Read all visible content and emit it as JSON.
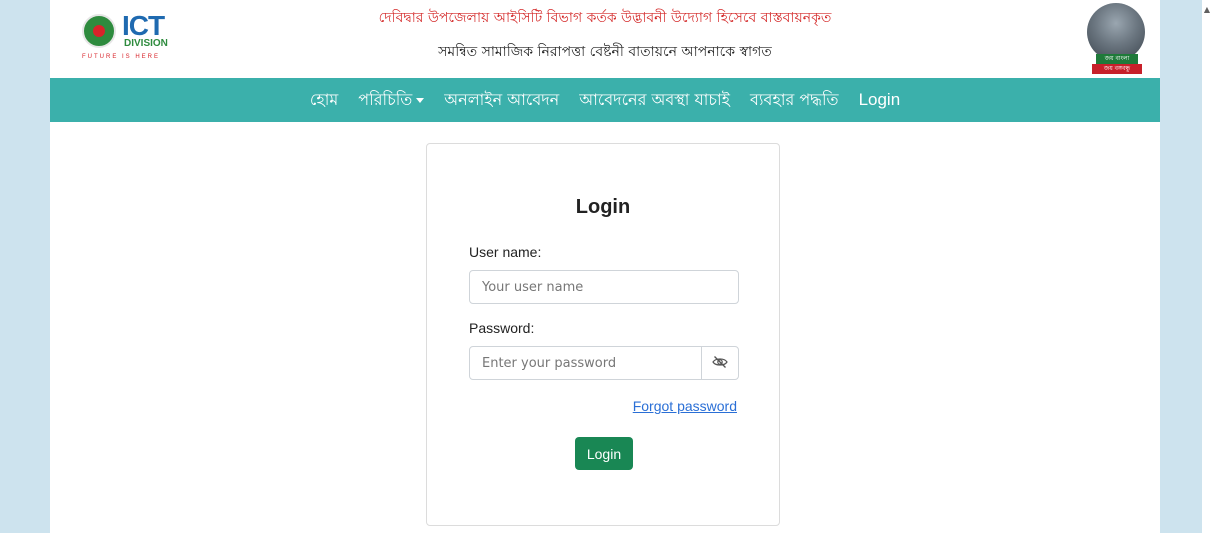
{
  "header": {
    "logo": {
      "name": "ICT",
      "division": "DIVISION",
      "tagline": "FUTURE IS HERE"
    },
    "line1": "দেবিদ্বার উপজেলায় আইসিটি বিভাগ কর্তক উদ্ভাবনী উদ্যোগ হিসেবে বাস্তবায়নকৃত",
    "line2": "সমন্বিত সামাজিক নিরাপত্তা বেষ্টনী বাতায়নে আপনাকে স্বাগত",
    "portrait": {
      "banner_top": "জয় বাংলা",
      "banner_bottom": "জয় বঙ্গবন্ধু"
    }
  },
  "nav": {
    "items": [
      {
        "label": "হোম"
      },
      {
        "label": "পরিচিতি"
      },
      {
        "label": "অনলাইন আবেদন"
      },
      {
        "label": "আবেদনের অবস্থা যাচাই"
      },
      {
        "label": "ব্যবহার পদ্ধতি"
      },
      {
        "label": "Login"
      }
    ]
  },
  "login": {
    "title": "Login",
    "username_label": "User name:",
    "username_placeholder": "Your user name",
    "username_value": "",
    "password_label": "Password:",
    "password_placeholder": "Enter your password",
    "password_value": "",
    "forgot_label": "Forgot password",
    "submit_label": "Login"
  },
  "colors": {
    "navbar": "#3bb0ab",
    "accent_red": "#d42a2a",
    "submit_button": "#198754",
    "link": "#2a6fd6",
    "side_background": "#cde3ee"
  },
  "icons": {
    "password_toggle": "eye-slash-icon",
    "dropdown": "caret-down-icon"
  }
}
